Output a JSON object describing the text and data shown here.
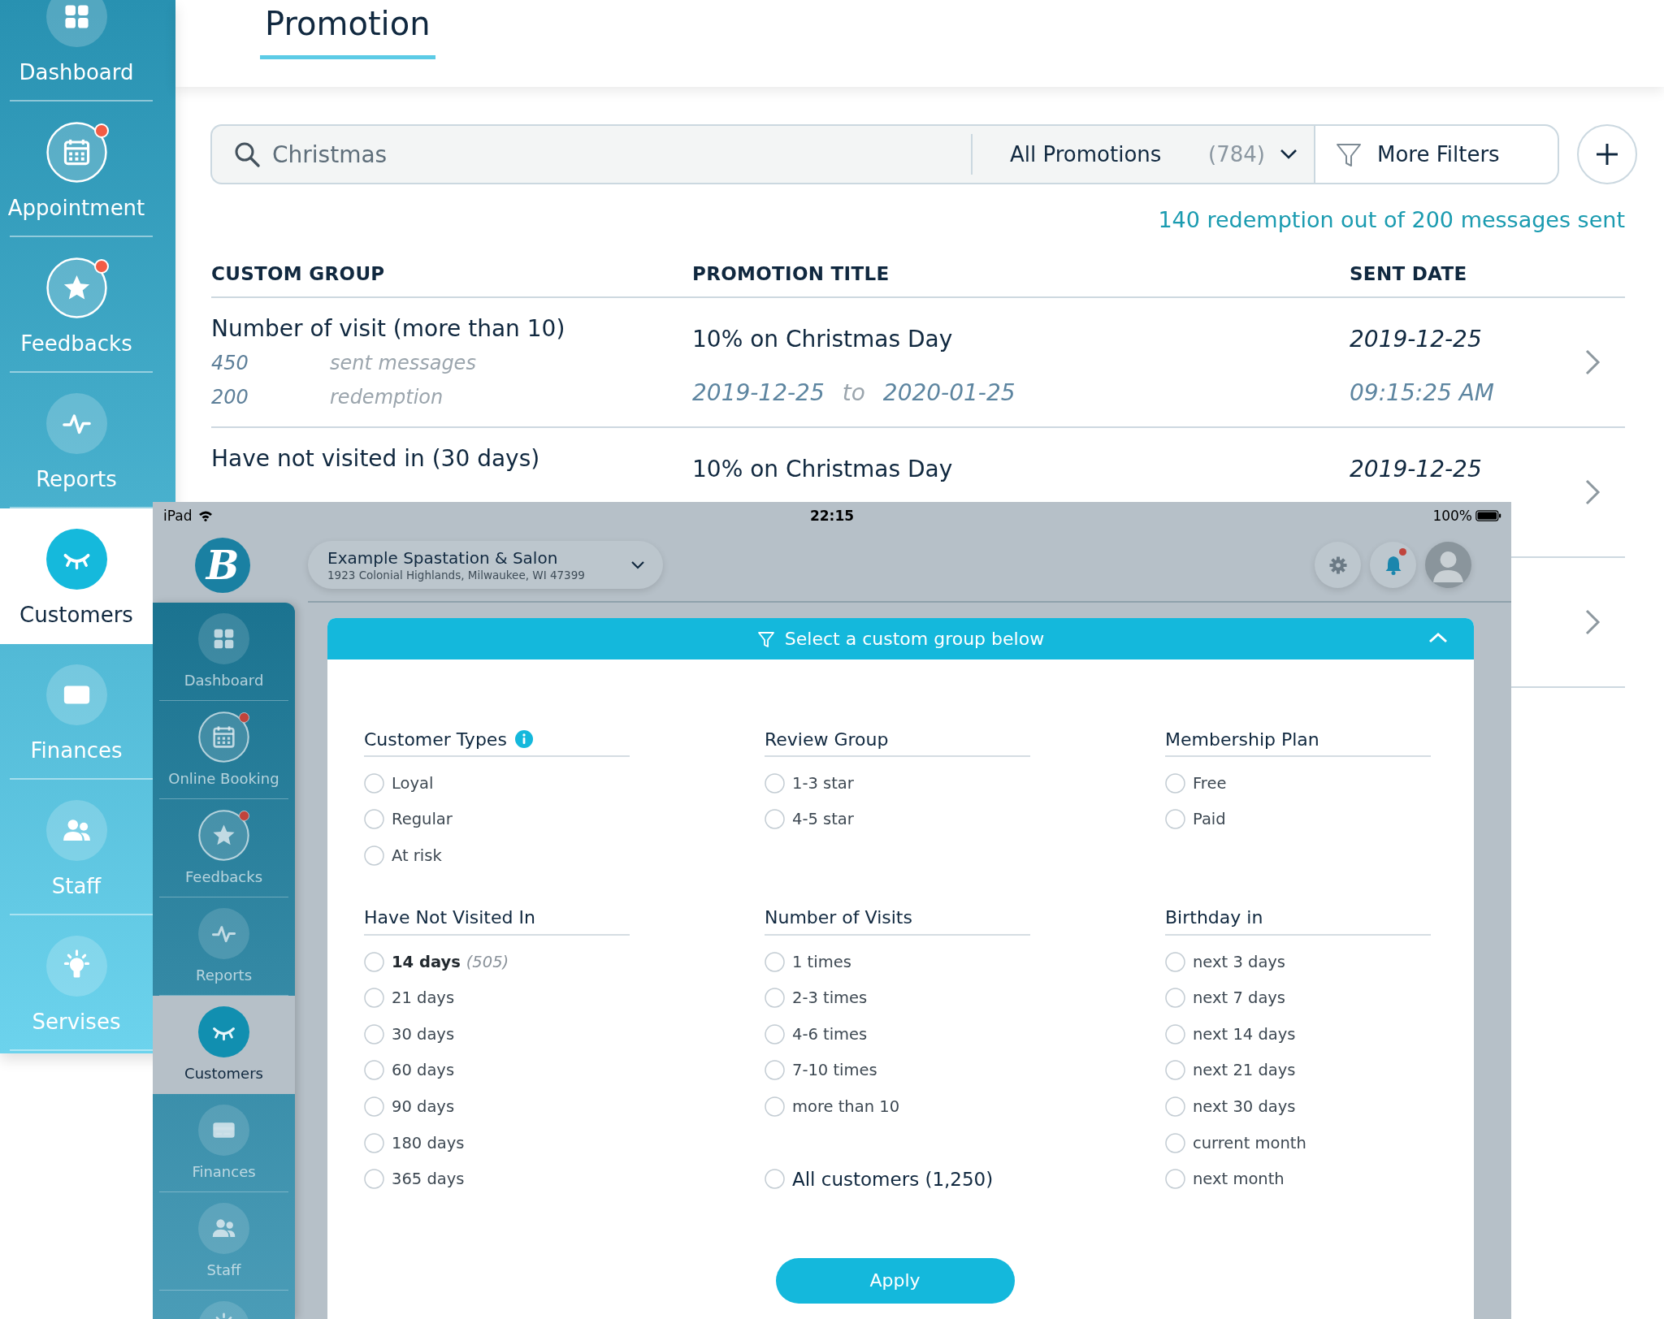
{
  "sidebar": {
    "items": [
      {
        "label": "Dashboard",
        "kind": "grid",
        "badge": false,
        "selected": false
      },
      {
        "label": "Appointment",
        "kind": "calendar",
        "badge": true,
        "selected": false
      },
      {
        "label": "Feedbacks",
        "kind": "star",
        "badge": true,
        "selected": false
      },
      {
        "label": "Reports",
        "kind": "pulse",
        "badge": false,
        "selected": false
      },
      {
        "label": "Customers",
        "kind": "eye",
        "badge": false,
        "selected": true
      },
      {
        "label": "Finances",
        "kind": "card",
        "badge": false,
        "selected": false
      },
      {
        "label": "Staff",
        "kind": "people",
        "badge": false,
        "selected": false
      },
      {
        "label": "Servises",
        "kind": "bulb",
        "badge": false,
        "selected": false
      }
    ]
  },
  "tabs": [
    {
      "label": "Promotion",
      "selected": true
    }
  ],
  "filters": {
    "search": {
      "value": "Christmas"
    },
    "dropdown": {
      "label": "All Promotions",
      "count": "(784)"
    },
    "more_filters": "More Filters"
  },
  "summary": "140 redemption out of 200 messages sent",
  "table": {
    "columns": [
      "CUSTOM GROUP",
      "PROMOTION TITLE",
      "SENT DATE"
    ],
    "rows": [
      {
        "group": "Number of visit (more than 10)",
        "stats": [
          {
            "count": "450",
            "label": "sent messages"
          },
          {
            "count": "200",
            "label": "redemption"
          }
        ],
        "title": "10% on Christmas Day",
        "period": {
          "start": "2019-12-25",
          "to": "to",
          "end": "2020-01-25"
        },
        "sent_date": "2019-12-25",
        "sent_time": "09:15:25 AM"
      },
      {
        "group": "Have not visited in (30 days)",
        "title": "10% on Christmas Day",
        "sent_date": "2019-12-25"
      },
      {}
    ]
  },
  "ipad": {
    "status_bar": {
      "device": "iPad",
      "time": "22:15",
      "battery": "100%"
    },
    "logo": "B",
    "location": {
      "name": "Example Spastation & Salon",
      "address": "1923 Colonial Highlands, Milwaukee, WI 47399"
    },
    "notifications": true,
    "sidebar": {
      "items": [
        {
          "label": "Dashboard",
          "kind": "grid",
          "badge": false,
          "selected": false
        },
        {
          "label": "Online Booking",
          "kind": "calendar",
          "badge": true,
          "selected": false
        },
        {
          "label": "Feedbacks",
          "kind": "star",
          "badge": true,
          "selected": false
        },
        {
          "label": "Reports",
          "kind": "pulse",
          "badge": false,
          "selected": false
        },
        {
          "label": "Customers",
          "kind": "eye",
          "badge": false,
          "selected": true
        },
        {
          "label": "Finances",
          "kind": "card",
          "badge": false,
          "selected": false
        },
        {
          "label": "Staff",
          "kind": "people",
          "badge": false,
          "selected": false
        },
        {
          "kind": "bulb",
          "badge": false,
          "selected": false
        }
      ]
    },
    "modal": {
      "title": "Select a custom group below",
      "expanded": true,
      "sections": [
        {
          "title": "Customer Types",
          "info": true,
          "options": [
            {
              "label": "Loyal",
              "selected": false
            },
            {
              "label": "Regular",
              "selected": false
            },
            {
              "label": "At risk",
              "selected": false
            }
          ]
        },
        {
          "title": "Review Group",
          "info": false,
          "options": [
            {
              "label": "1-3 star",
              "selected": false
            },
            {
              "label": "4-5 star",
              "selected": false
            }
          ]
        },
        {
          "title": "Membership Plan",
          "info": false,
          "options": [
            {
              "label": "Free",
              "selected": false
            },
            {
              "label": "Paid",
              "selected": false
            }
          ]
        },
        {
          "title": "Have Not Visited In",
          "info": false,
          "options": [
            {
              "label": "14 days",
              "count": "(505)",
              "selected": false
            },
            {
              "label": "21 days",
              "selected": false
            },
            {
              "label": "30 days",
              "selected": false
            },
            {
              "label": "60 days",
              "selected": false
            },
            {
              "label": "90 days",
              "selected": false
            },
            {
              "label": "180 days",
              "selected": false
            },
            {
              "label": "365 days",
              "selected": false
            }
          ]
        },
        {
          "title": "Number of Visits",
          "info": false,
          "options": [
            {
              "kind": "option",
              "label": "1 times",
              "selected": false
            },
            {
              "kind": "option",
              "label": "2-3 times",
              "selected": false
            },
            {
              "kind": "option",
              "label": "4-6 times",
              "selected": false
            },
            {
              "kind": "option",
              "label": "7-10 times",
              "selected": false
            },
            {
              "kind": "option",
              "label": "more than 10",
              "selected": false
            },
            {
              "kind": "all",
              "label": "All customers (1,250)",
              "selected": false
            }
          ]
        },
        {
          "title": "Birthday in",
          "info": false,
          "options": [
            {
              "label": "next 3 days",
              "selected": false
            },
            {
              "label": "next 7 days",
              "selected": false
            },
            {
              "label": "next 14 days",
              "selected": false
            },
            {
              "label": "next 21 days",
              "selected": false
            },
            {
              "label": "next 30 days",
              "selected": false
            },
            {
              "label": "current month",
              "selected": false
            },
            {
              "label": "next month",
              "selected": false
            }
          ]
        }
      ],
      "apply": "Apply"
    }
  }
}
